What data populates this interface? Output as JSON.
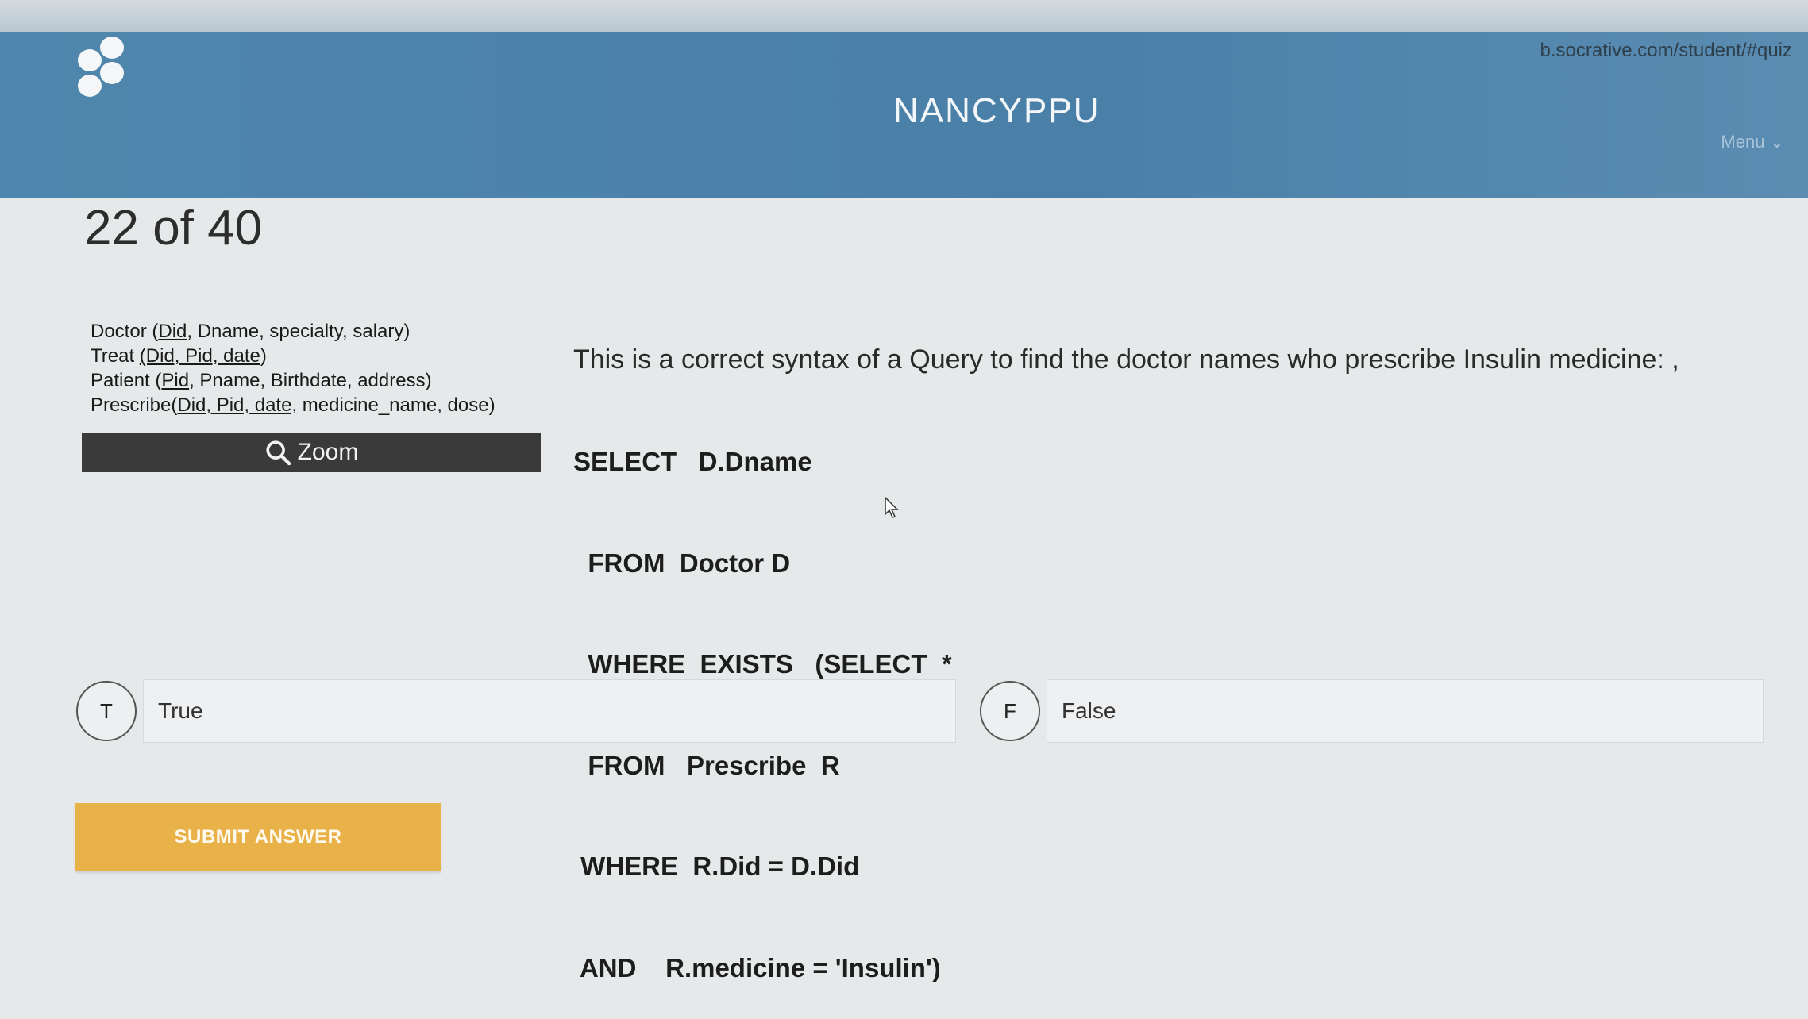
{
  "browser": {
    "url": "b.socrative.com/student/#quiz"
  },
  "header": {
    "title": "NANCYPPU",
    "menu_label": "Menu"
  },
  "quiz": {
    "counter": "22 of 40"
  },
  "schema": {
    "doctor": {
      "name": "Doctor (",
      "key": "Did",
      "rest": ", Dname, specialty, salary)"
    },
    "treat": {
      "name": "Treat ",
      "key": "(Did, Pid, date",
      "rest": ")"
    },
    "patient": {
      "name": "Patient (",
      "key": "Pid",
      "rest": ", Pname, Birthdate, address)"
    },
    "prescribe": {
      "name": "Prescribe(",
      "key": "Did, Pid, date,",
      "rest": " medicine_name, dose)"
    }
  },
  "zoom": {
    "label": "Zoom"
  },
  "question": {
    "text": "This  is a correct syntax of a Query  to find the doctor names who prescribe Insulin medicine: ,",
    "sql": [
      "SELECT   D.Dname",
      "  FROM  Doctor D",
      "  WHERE  EXISTS   (SELECT  *",
      "  FROM   Prescribe  R",
      " WHERE  R.Did = D.Did",
      " AND    R.medicine = 'Insulin')"
    ]
  },
  "options": [
    {
      "letter": "T",
      "label": "True"
    },
    {
      "letter": "F",
      "label": "False"
    }
  ],
  "submit": {
    "label": "SUBMIT ANSWER"
  }
}
